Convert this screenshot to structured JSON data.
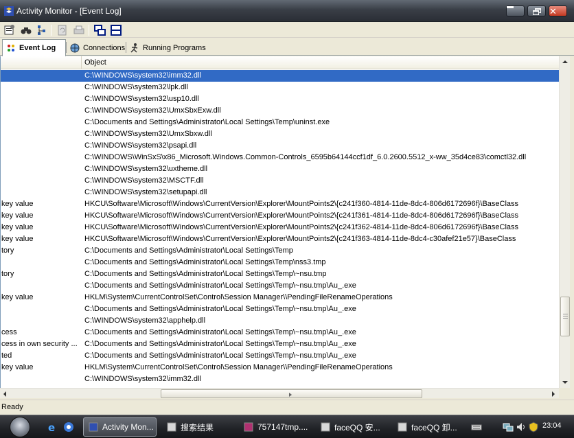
{
  "window": {
    "title": "Activity Monitor - [Event Log]"
  },
  "toolbar": {
    "icons": [
      "properties-icon",
      "find-icon",
      "tree-icon",
      "refresh-icon",
      "print-icon",
      "tile-horizontal-icon",
      "tile-vertical-icon"
    ]
  },
  "tabs": [
    {
      "label": "Event Log",
      "icon": "event-log-icon"
    },
    {
      "label": "Connections",
      "icon": "connections-icon"
    },
    {
      "label": "Running Programs",
      "icon": "running-programs-icon"
    }
  ],
  "list": {
    "columns": [
      "",
      "Object"
    ],
    "rows": [
      {
        "c1": "",
        "c2": "C:\\WINDOWS\\system32\\imm32.dll",
        "selected": true
      },
      {
        "c1": "",
        "c2": "C:\\WINDOWS\\system32\\lpk.dll"
      },
      {
        "c1": "",
        "c2": "C:\\WINDOWS\\system32\\usp10.dll"
      },
      {
        "c1": "",
        "c2": "C:\\WINDOWS\\system32\\UmxSbxExw.dll"
      },
      {
        "c1": "",
        "c2": "C:\\Documents and Settings\\Administrator\\Local Settings\\Temp\\uninst.exe"
      },
      {
        "c1": "",
        "c2": "C:\\WINDOWS\\system32\\UmxSbxw.dll"
      },
      {
        "c1": "",
        "c2": "C:\\WINDOWS\\system32\\psapi.dll"
      },
      {
        "c1": "",
        "c2": "C:\\WINDOWS\\WinSxS\\x86_Microsoft.Windows.Common-Controls_6595b64144ccf1df_6.0.2600.5512_x-ww_35d4ce83\\comctl32.dll"
      },
      {
        "c1": "",
        "c2": "C:\\WINDOWS\\system32\\uxtheme.dll"
      },
      {
        "c1": "",
        "c2": "C:\\WINDOWS\\system32\\MSCTF.dll"
      },
      {
        "c1": "",
        "c2": "C:\\WINDOWS\\system32\\setupapi.dll"
      },
      {
        "c1": "key value",
        "c2": "HKCU\\Software\\Microsoft\\Windows\\CurrentVersion\\Explorer\\MountPoints2\\{c241f360-4814-11de-8dc4-806d6172696f}\\BaseClass"
      },
      {
        "c1": "key value",
        "c2": "HKCU\\Software\\Microsoft\\Windows\\CurrentVersion\\Explorer\\MountPoints2\\{c241f361-4814-11de-8dc4-806d6172696f}\\BaseClass"
      },
      {
        "c1": "key value",
        "c2": "HKCU\\Software\\Microsoft\\Windows\\CurrentVersion\\Explorer\\MountPoints2\\{c241f362-4814-11de-8dc4-806d6172696f}\\BaseClass"
      },
      {
        "c1": "key value",
        "c2": "HKCU\\Software\\Microsoft\\Windows\\CurrentVersion\\Explorer\\MountPoints2\\{c241f363-4814-11de-8dc4-c30afef21e57}\\BaseClass"
      },
      {
        "c1": "tory",
        "c2": "C:\\Documents and Settings\\Administrator\\Local Settings\\Temp"
      },
      {
        "c1": "",
        "c2": "C:\\Documents and Settings\\Administrator\\Local Settings\\Temp\\nss3.tmp"
      },
      {
        "c1": "tory",
        "c2": "C:\\Documents and Settings\\Administrator\\Local Settings\\Temp\\~nsu.tmp"
      },
      {
        "c1": "",
        "c2": "C:\\Documents and Settings\\Administrator\\Local Settings\\Temp\\~nsu.tmp\\Au_.exe"
      },
      {
        "c1": "key value",
        "c2": "HKLM\\System\\CurrentControlSet\\Control\\Session Manager\\\\PendingFileRenameOperations"
      },
      {
        "c1": "",
        "c2": "C:\\Documents and Settings\\Administrator\\Local Settings\\Temp\\~nsu.tmp\\Au_.exe"
      },
      {
        "c1": "",
        "c2": "C:\\WINDOWS\\system32\\apphelp.dll"
      },
      {
        "c1": "cess",
        "c2": "C:\\Documents and Settings\\Administrator\\Local Settings\\Temp\\~nsu.tmp\\Au_.exe"
      },
      {
        "c1": "cess in own security ...",
        "c2": "C:\\Documents and Settings\\Administrator\\Local Settings\\Temp\\~nsu.tmp\\Au_.exe"
      },
      {
        "c1": "ted",
        "c2": "C:\\Documents and Settings\\Administrator\\Local Settings\\Temp\\~nsu.tmp\\Au_.exe"
      },
      {
        "c1": "key value",
        "c2": "HKLM\\System\\CurrentControlSet\\Control\\Session Manager\\\\PendingFileRenameOperations"
      },
      {
        "c1": "",
        "c2": "C:\\WINDOWS\\system32\\imm32.dll"
      }
    ]
  },
  "statusbar": {
    "text": "Ready"
  },
  "taskbar": {
    "tasks": [
      {
        "label": "Activity Mon...",
        "icon": "activity-monitor-icon",
        "active": true
      },
      {
        "label": "搜索结果",
        "icon": "search-results-icon"
      },
      {
        "label": "757147tmp....",
        "icon": "archive-icon"
      },
      {
        "label": "faceQQ 安...",
        "icon": "installer-icon"
      },
      {
        "label": "faceQQ 卸...",
        "icon": "uninstaller-icon"
      }
    ],
    "clock": "23:04"
  },
  "colors": {
    "selection": "#316ac5",
    "titlebar": "#3a3f47",
    "chrome": "#ece9d8"
  }
}
